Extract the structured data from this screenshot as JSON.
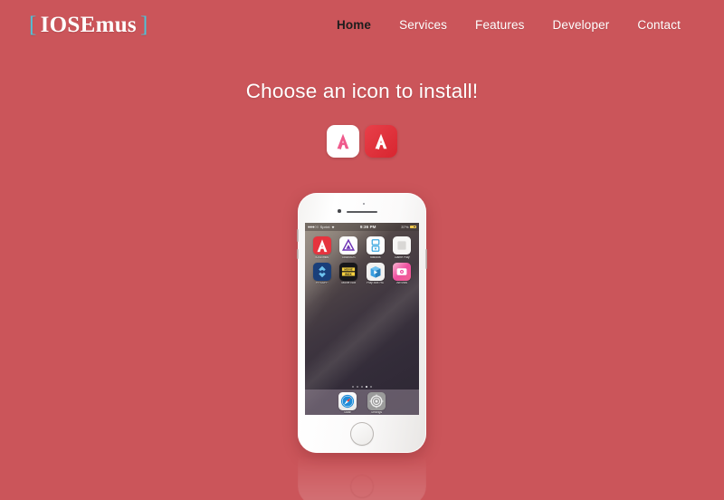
{
  "site": {
    "background_color": "#cb555a",
    "brand": {
      "open_bracket": "[",
      "name": "IOSEmus",
      "close_bracket": "]",
      "bracket_color": "#4fc3d9",
      "text_color": "#ffffff"
    }
  },
  "nav": {
    "items": [
      {
        "label": "Home",
        "active": true
      },
      {
        "label": "Services",
        "active": false
      },
      {
        "label": "Features",
        "active": false
      },
      {
        "label": "Developer",
        "active": false
      },
      {
        "label": "Contact",
        "active": false
      }
    ]
  },
  "hero": {
    "heading": "Choose an icon to install!"
  },
  "icon_choices": [
    {
      "name": "iosemus-light-icon",
      "style": "light",
      "background": "#ffffff",
      "glyph_color": "#ef5a8c",
      "label": "A"
    },
    {
      "name": "iosemus-red-icon",
      "style": "dark",
      "background": "#e03640",
      "glyph_color": "#ffffff",
      "label": "A"
    }
  ],
  "phone": {
    "device": "iPhone",
    "body_color": "#fbfafa",
    "status_bar": {
      "signal": "●●●○○",
      "carrier": "Sprint",
      "wifi": "wifi-icon",
      "time": "9:36 PM",
      "battery_percent": "37%",
      "battery_color": "#f2c94c"
    },
    "home_apps": [
      {
        "label": "IOSEmus",
        "icon": "iosemus-app-icon"
      },
      {
        "label": "GBA4iOS",
        "icon": "gba4ios-app-icon"
      },
      {
        "label": "nds4ios",
        "icon": "nds4ios-app-icon"
      },
      {
        "label": "Game Play",
        "icon": "gameplay-app-icon"
      },
      {
        "label": "PPSSPP",
        "icon": "ppsspp-app-icon"
      },
      {
        "label": "Movie Box",
        "icon": "moviebox-app-icon"
      },
      {
        "label": "Play Box HD",
        "icon": "playboxhd-app-icon"
      },
      {
        "label": "AirShou",
        "icon": "airshou-app-icon"
      }
    ],
    "page_dots": {
      "count": 5,
      "active_index": 3
    },
    "dock_apps": [
      {
        "label": "Safari",
        "icon": "safari-app-icon"
      },
      {
        "label": "Settings",
        "icon": "settings-app-icon"
      }
    ]
  }
}
